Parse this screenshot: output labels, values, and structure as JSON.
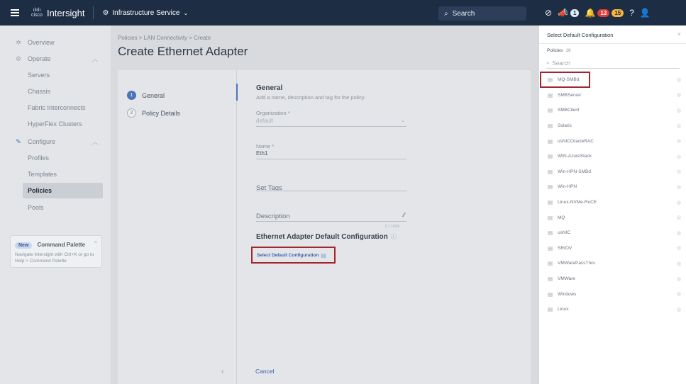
{
  "topbar": {
    "logo": "cisco",
    "app_name": "Intersight",
    "service": "Infrastructure Service",
    "search_label": "Search",
    "announce_count": "1",
    "alarm_critical": "13",
    "alarm_warning": "15"
  },
  "sidebar": {
    "items": [
      {
        "label": "Overview"
      },
      {
        "label": "Operate"
      },
      {
        "label": "Servers"
      },
      {
        "label": "Chassis"
      },
      {
        "label": "Fabric Interconnects"
      },
      {
        "label": "HyperFlex Clusters"
      },
      {
        "label": "Configure"
      },
      {
        "label": "Profiles"
      },
      {
        "label": "Templates"
      },
      {
        "label": "Policies"
      },
      {
        "label": "Pools"
      }
    ],
    "command_palette": {
      "badge": "New",
      "title": "Command Palette",
      "text": "Navigate Intersight with Ctrl+K or go to Help > Command Palette"
    }
  },
  "main": {
    "breadcrumb": "Policies  >  LAN Connectivity  >  Create",
    "title": "Create Ethernet Adapter",
    "steps": [
      {
        "num": "1",
        "label": "General"
      },
      {
        "num": "2",
        "label": "Policy Details"
      }
    ],
    "form": {
      "heading": "General",
      "subheading": "Add a name, description and tag for the policy.",
      "org_label": "Organization *",
      "org_value": "default",
      "name_label": "Name *",
      "name_value": "Eth1",
      "tags_label": "Set Tags",
      "desc_label": "Description",
      "desc_count": "0 / 1024",
      "default_config_heading": "Ethernet Adapter Default Configuration",
      "select_default_link": "Select Default Configuration",
      "cancel_label": "Cancel"
    }
  },
  "panel": {
    "title": "Select Default Configuration",
    "policies_label": "Policies",
    "policies_count": "16",
    "search_placeholder": "Search",
    "items": [
      "MQ-SMBd",
      "SMBServer",
      "SMBClient",
      "Solaris",
      "usNICOracleRAC",
      "WIN-AzureStack",
      "Win-HPN-SMBd",
      "Win-HPN",
      "Linux-NVMe-RoCE",
      "MQ",
      "usNIC",
      "SRIOV",
      "VMWarePassThru",
      "VMWare",
      "Windows",
      "Linux"
    ]
  }
}
